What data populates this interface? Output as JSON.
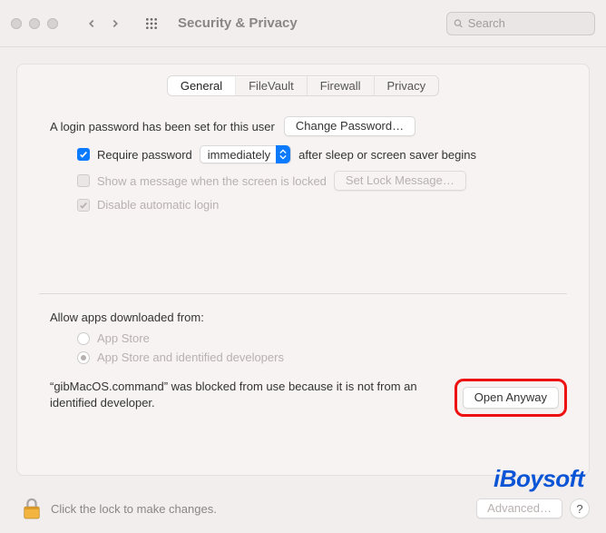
{
  "window": {
    "title": "Security & Privacy",
    "search_placeholder": "Search"
  },
  "tabs": {
    "general": "General",
    "filevault": "FileVault",
    "firewall": "Firewall",
    "privacy": "Privacy",
    "active": "general"
  },
  "login": {
    "password_set_text": "A login password has been set for this user",
    "change_password_btn": "Change Password…",
    "require_password_label_before": "Require password",
    "require_password_delay": "immediately",
    "require_password_label_after": "after sleep or screen saver begins",
    "require_password_checked": true,
    "show_message_label": "Show a message when the screen is locked",
    "show_message_checked": false,
    "set_lock_message_btn": "Set Lock Message…",
    "disable_auto_login_label": "Disable automatic login",
    "disable_auto_login_checked": true
  },
  "allow_apps": {
    "heading": "Allow apps downloaded from:",
    "app_store": "App Store",
    "app_store_identified": "App Store and identified developers",
    "selected": "app_store_identified"
  },
  "blocked": {
    "message": "“gibMacOS.command” was blocked from use because it is not from an identified developer.",
    "open_anyway_btn": "Open Anyway"
  },
  "footer": {
    "lock_text": "Click the lock to make changes.",
    "advanced_btn": "Advanced…",
    "help_label": "?"
  },
  "watermark": "iBoysoft"
}
